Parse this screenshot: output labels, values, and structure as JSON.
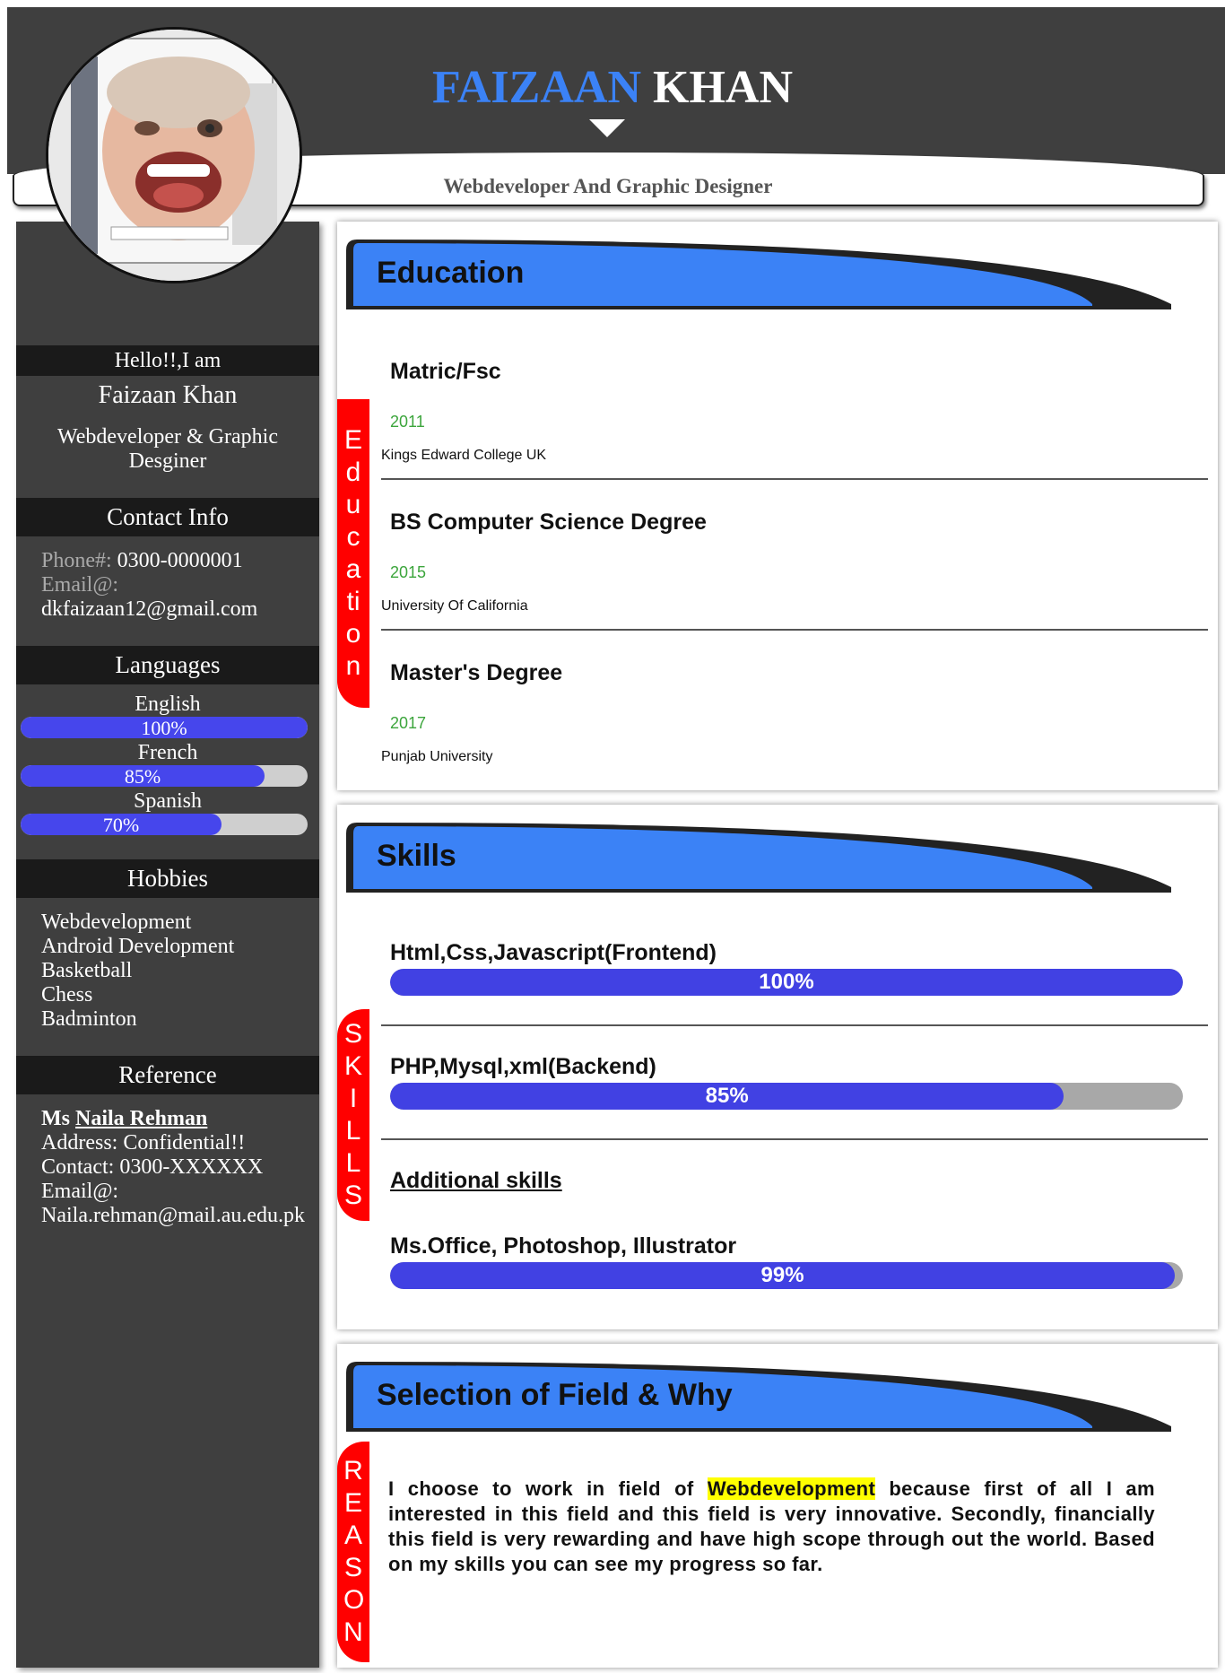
{
  "header": {
    "first_name": "FAIZAAN",
    "last_name": "KHAN",
    "subtitle": "Webdeveloper And Graphic Designer"
  },
  "sidebar": {
    "greeting": "Hello!!,I am",
    "name": "Faizaan Khan",
    "role": "Webdeveloper & Graphic Desginer",
    "contact_heading": "Contact Info",
    "phone_label": "Phone#:",
    "phone_value": "0300-0000001",
    "email_label": "Email@:",
    "email_value": "dkfaizaan12@gmail.com",
    "languages_heading": "Languages",
    "languages": [
      {
        "name": "English",
        "percent": 100,
        "label": "100%"
      },
      {
        "name": "French",
        "percent": 85,
        "label": "85%"
      },
      {
        "name": "Spanish",
        "percent": 70,
        "label": "70%"
      }
    ],
    "hobbies_heading": "Hobbies",
    "hobbies": [
      "Webdevelopment",
      "Android Development",
      "Basketball",
      "Chess",
      "Badminton"
    ],
    "reference_heading": "Reference",
    "reference": {
      "prefix": "Ms",
      "name": "Naila Rehman",
      "address": "Address: Confidential!!",
      "contact": "Contact: 0300-XXXXXX",
      "email_label": "Email@:",
      "email": "Naila.rehman@mail.au.edu.pk"
    }
  },
  "education": {
    "heading": "Education",
    "tab": "Education",
    "items": [
      {
        "title": "Matric/Fsc",
        "year": "2011",
        "school": "Kings Edward College UK"
      },
      {
        "title": "BS Computer Science Degree",
        "year": "2015",
        "school": "University Of California"
      },
      {
        "title": "Master's Degree",
        "year": "2017",
        "school": "Punjab University"
      }
    ]
  },
  "skills": {
    "heading": "Skills",
    "tab": "SKILLS",
    "items": [
      {
        "title": "Html,Css,Javascript(Frontend)",
        "percent": 100,
        "label": "100%"
      },
      {
        "title": "PHP,Mysql,xml(Backend)",
        "percent": 85,
        "label": "85%"
      }
    ],
    "additional_heading": "Additional skills",
    "additional": {
      "title": "Ms.Office, Photoshop, Illustrator",
      "percent": 99,
      "label": "99%"
    }
  },
  "reason": {
    "heading": "Selection of Field & Why",
    "tab": "REASON",
    "text_before": "I choose to work in field of ",
    "highlight": "Webdevelopment",
    "text_after": " because first of all I am interested in this field and this field is very innovative. Secondly, financially this field is very rewarding and have high scope through out the world. Based on my skills you can see my progress so far."
  },
  "colors": {
    "accent_blue": "#3b82f6",
    "bar_fill": "#4141e3",
    "tab_red": "#ff0000",
    "year_green": "#3ca53c",
    "sidebar_bg": "#3f3f3f"
  }
}
